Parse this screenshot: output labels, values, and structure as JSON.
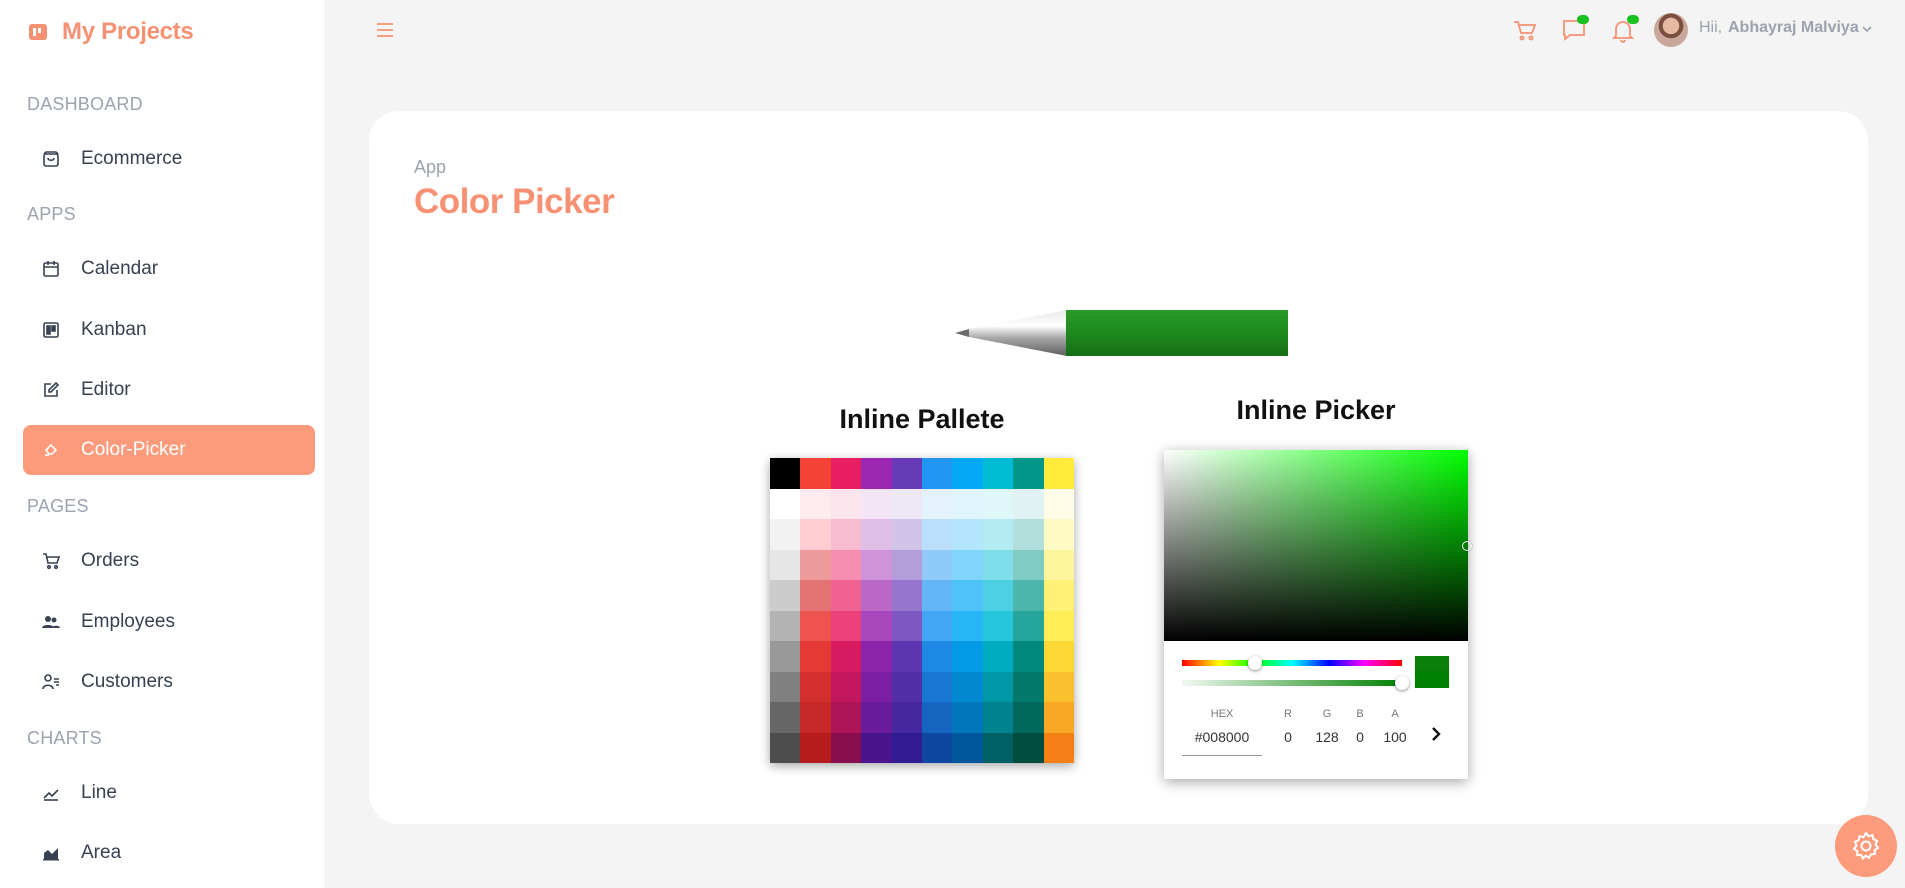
{
  "brand": {
    "name": "My Projects",
    "icon": "kanban-board-icon",
    "color": "#f69273"
  },
  "sidebar": {
    "sections": [
      {
        "title": "DASHBOARD",
        "items": [
          {
            "label": "Ecommerce",
            "icon": "shopping-bag-icon"
          }
        ]
      },
      {
        "title": "APPS",
        "items": [
          {
            "label": "Calendar",
            "icon": "calendar-icon"
          },
          {
            "label": "Kanban",
            "icon": "kanban-icon"
          },
          {
            "label": "Editor",
            "icon": "edit-icon"
          },
          {
            "label": "Color-Picker",
            "icon": "paint-bucket-icon",
            "active": true
          }
        ]
      },
      {
        "title": "PAGES",
        "items": [
          {
            "label": "Orders",
            "icon": "cart-icon"
          },
          {
            "label": "Employees",
            "icon": "users-icon"
          },
          {
            "label": "Customers",
            "icon": "user-list-icon"
          }
        ]
      },
      {
        "title": "CHARTS",
        "items": [
          {
            "label": "Line",
            "icon": "line-chart-icon"
          },
          {
            "label": "Area",
            "icon": "area-chart-icon"
          }
        ]
      }
    ],
    "active_color": "#fb9b7b"
  },
  "header": {
    "greeting": "Hii,",
    "user_name": "Abhayraj Malviya",
    "icons": [
      "menu-icon",
      "cart-icon",
      "chat-icon",
      "bell-icon",
      "avatar",
      "chevron-down-icon"
    ],
    "notification_dot_color": "#19c21e"
  },
  "page": {
    "breadcrumb": "App",
    "title": "Color Picker"
  },
  "pen": {
    "color": "#1e8a1e"
  },
  "palette": {
    "title": "Inline Pallete",
    "colors": [
      [
        "#000000",
        "#f44336",
        "#e91e63",
        "#9c27b0",
        "#673ab7",
        "#2196f3",
        "#03a9f4",
        "#00bcd4",
        "#009688",
        "#ffeb3b"
      ],
      [
        "#ffffff",
        "#ffebee",
        "#fce4ec",
        "#f3e5f5",
        "#ede7f6",
        "#e3f2fd",
        "#e1f5fe",
        "#e0f7fa",
        "#e0f2f1",
        "#fffde7"
      ],
      [
        "#f2f2f2",
        "#ffcdd2",
        "#f8bbd0",
        "#e1bee7",
        "#d1c4e9",
        "#bbdefb",
        "#b3e5fc",
        "#b2ebf2",
        "#b2dfdb",
        "#fff9c4"
      ],
      [
        "#e6e6e6",
        "#ef9a9a",
        "#f48fb1",
        "#ce93d8",
        "#b39ddb",
        "#90caf9",
        "#81d4fa",
        "#80deea",
        "#80cbc4",
        "#fff59d"
      ],
      [
        "#cccccc",
        "#e57373",
        "#f06292",
        "#ba68c8",
        "#9575cd",
        "#64b5f6",
        "#4fc3f7",
        "#4dd0e1",
        "#4db6ac",
        "#fff176"
      ],
      [
        "#b3b3b3",
        "#ef5350",
        "#ec407a",
        "#ab47bc",
        "#7e57c2",
        "#42a5f5",
        "#29b6f6",
        "#26c6da",
        "#26a69a",
        "#ffee58"
      ],
      [
        "#999999",
        "#e53935",
        "#d81b60",
        "#8e24aa",
        "#5e35b1",
        "#1e88e5",
        "#039be5",
        "#00acc1",
        "#00897b",
        "#fdd835"
      ],
      [
        "#808080",
        "#d32f2f",
        "#c2185b",
        "#7b1fa2",
        "#512da8",
        "#1976d2",
        "#0288d1",
        "#0097a7",
        "#00796b",
        "#fbc02d"
      ],
      [
        "#666666",
        "#c62828",
        "#ad1457",
        "#6a1b9a",
        "#4527a0",
        "#1565c0",
        "#0277bd",
        "#00838f",
        "#00695c",
        "#f9a825"
      ],
      [
        "#4d4d4d",
        "#b71c1c",
        "#880e4f",
        "#4a148c",
        "#311b92",
        "#0d47a1",
        "#01579b",
        "#006064",
        "#004d40",
        "#f57f17"
      ]
    ]
  },
  "picker": {
    "title": "Inline Picker",
    "hue_color": "#00ff00",
    "selected_color": "#008000",
    "hue_position": 0.33,
    "alpha_position": 1.0,
    "fields": {
      "hex": {
        "label": "HEX",
        "value": "#008000"
      },
      "r": {
        "label": "R",
        "value": "0"
      },
      "g": {
        "label": "G",
        "value": "128"
      },
      "b": {
        "label": "B",
        "value": "0"
      },
      "a": {
        "label": "A",
        "value": "100"
      }
    },
    "next_icon": "chevron-right-icon"
  },
  "settings_fab": {
    "icon": "gear-icon",
    "color": "#fb9b7b"
  }
}
